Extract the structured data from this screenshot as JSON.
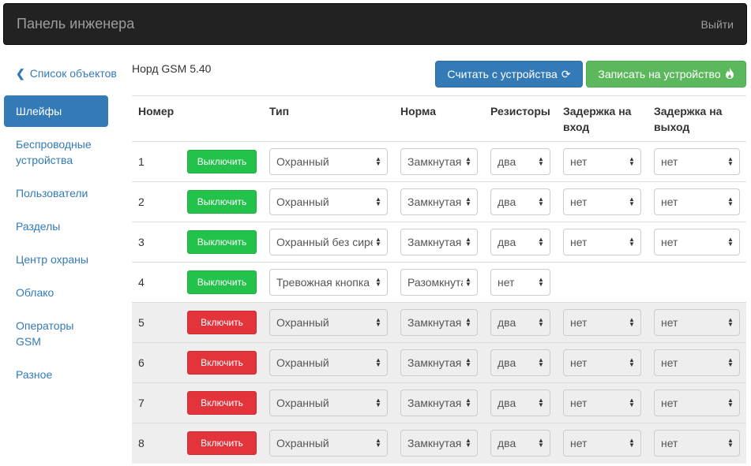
{
  "navbar": {
    "brand": "Панель инженера",
    "logout": "Выйти"
  },
  "back_link": "Список объектов",
  "sidebar": {
    "items": [
      {
        "label": "Шлейфы",
        "active": true
      },
      {
        "label": "Беспроводные устройства"
      },
      {
        "label": "Пользователи"
      },
      {
        "label": "Разделы"
      },
      {
        "label": "Центр охраны"
      },
      {
        "label": "Облако"
      },
      {
        "label": "Операторы GSM"
      },
      {
        "label": "Разное"
      }
    ]
  },
  "device_title": "Норд GSM 5.40",
  "actions": {
    "read": "Считать с устройства",
    "write": "Записать на устройство"
  },
  "colors": {
    "primary": "#337ab7",
    "success": "#5cb85c",
    "enable_red": "#e3343c",
    "disable_green": "#23c24b"
  },
  "table": {
    "headers": {
      "num": "Номер",
      "type": "Тип",
      "norm": "Норма",
      "resistors": "Резисторы",
      "delay_in": "Задержка на вход",
      "delay_out": "Задержка на выход"
    },
    "rows": [
      {
        "num": "1",
        "button": "Выключить",
        "type": "Охранный",
        "norm": "Замкнутая",
        "resistors": "два",
        "delay_in": "нет",
        "delay_out": "нет"
      },
      {
        "num": "2",
        "button": "Выключить",
        "type": "Охранный",
        "norm": "Замкнутая",
        "resistors": "два",
        "delay_in": "нет",
        "delay_out": "нет"
      },
      {
        "num": "3",
        "button": "Выключить",
        "type": "Охранный без сирены",
        "norm": "Замкнутая",
        "resistors": "два",
        "delay_in": "нет",
        "delay_out": "нет"
      },
      {
        "num": "4",
        "button": "Выключить",
        "type": "Тревожная кнопка",
        "norm": "Разомкнутая",
        "resistors": "нет"
      },
      {
        "num": "5",
        "button": "Включить",
        "type": "Охранный",
        "norm": "Замкнутая",
        "resistors": "два",
        "delay_in": "нет",
        "delay_out": "нет"
      },
      {
        "num": "6",
        "button": "Включить",
        "type": "Охранный",
        "norm": "Замкнутая",
        "resistors": "два",
        "delay_in": "нет",
        "delay_out": "нет"
      },
      {
        "num": "7",
        "button": "Включить",
        "type": "Охранный",
        "norm": "Замкнутая",
        "resistors": "два",
        "delay_in": "нет",
        "delay_out": "нет"
      },
      {
        "num": "8",
        "button": "Включить",
        "type": "Охранный",
        "norm": "Замкнутая",
        "resistors": "два",
        "delay_in": "нет",
        "delay_out": "нет"
      }
    ]
  }
}
